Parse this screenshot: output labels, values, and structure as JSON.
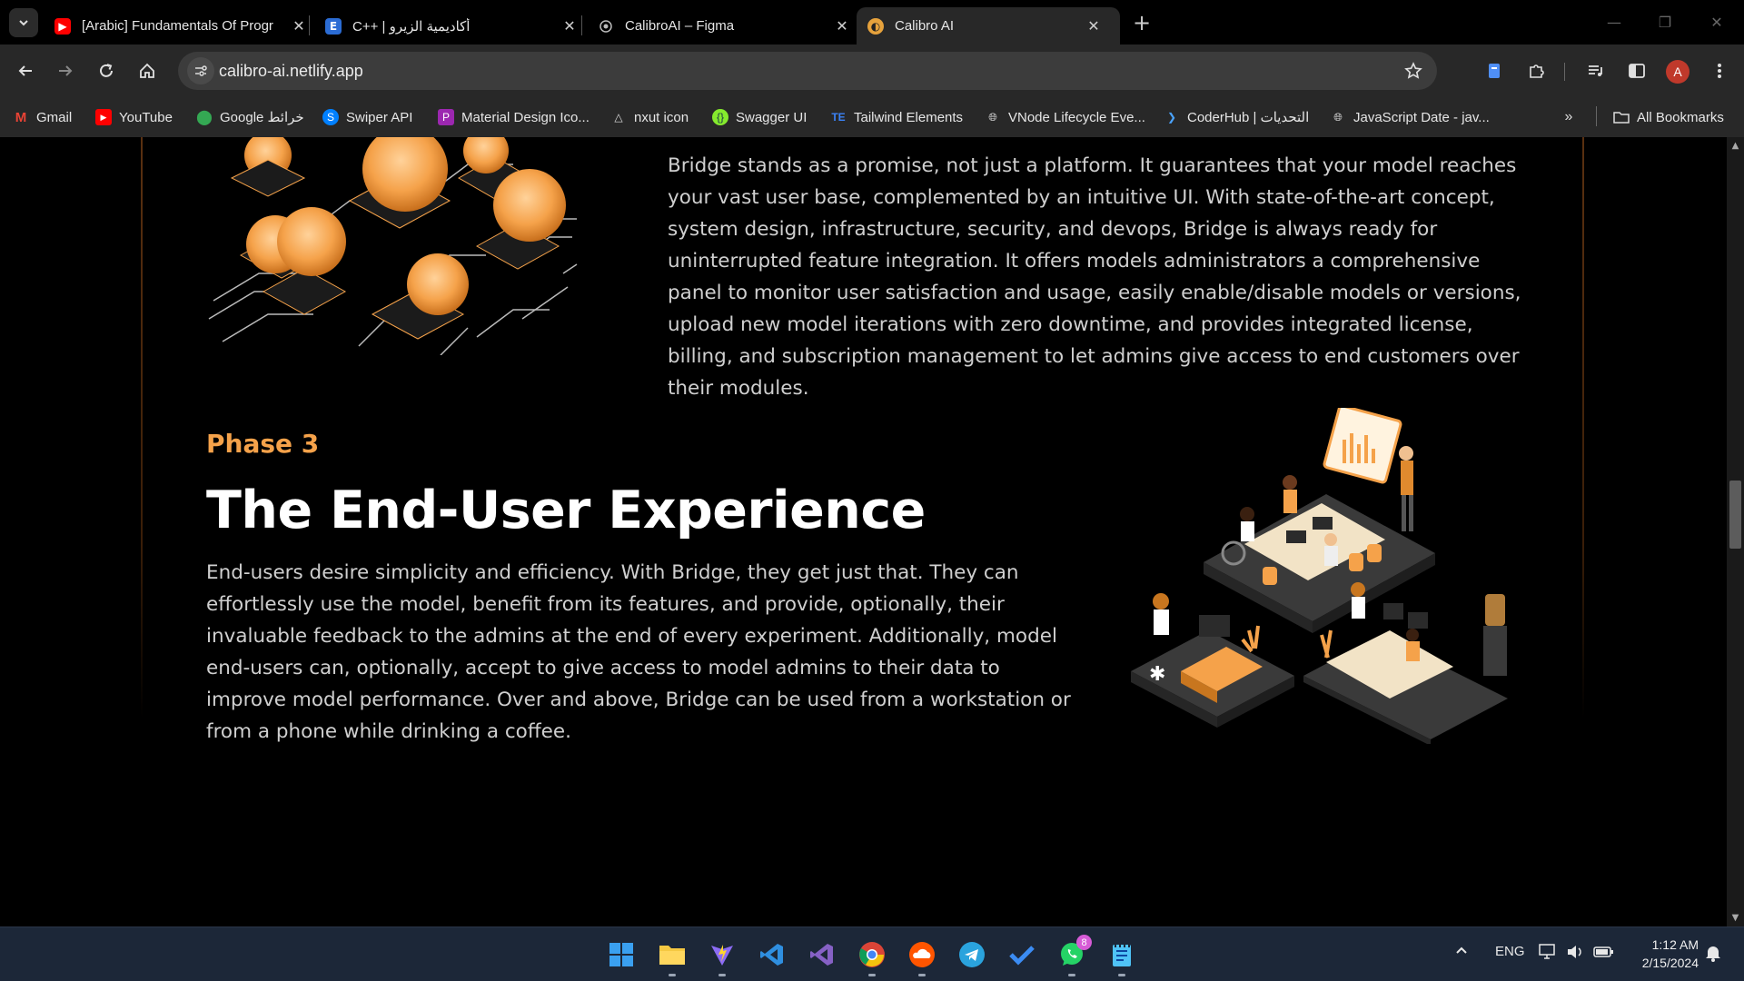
{
  "browser": {
    "tabs": [
      {
        "title": "[Arabic] Fundamentals Of Progr",
        "favicon": "youtube-icon",
        "active": false
      },
      {
        "title": "C++ | أكاديمية الزيرو",
        "favicon": "e-icon",
        "active": false
      },
      {
        "title": "CalibroAI – Figma",
        "favicon": "figma-icon",
        "active": false
      },
      {
        "title": "Calibro AI",
        "favicon": "calibro-icon",
        "active": true
      }
    ],
    "url": "calibro-ai.netlify.app",
    "avatar_letter": "A",
    "bookmarks": [
      {
        "label": "Gmail",
        "icon": "gmail-icon"
      },
      {
        "label": "YouTube",
        "icon": "youtube-icon"
      },
      {
        "label": "Google خرائط",
        "icon": "maps-icon"
      },
      {
        "label": "Swiper API",
        "icon": "swiper-icon"
      },
      {
        "label": "Material Design Ico...",
        "icon": "material-icon"
      },
      {
        "label": "nxut icon",
        "icon": "nuxt-icon"
      },
      {
        "label": "Swagger UI",
        "icon": "swagger-icon"
      },
      {
        "label": "Tailwind Elements",
        "icon": "tailwind-icon"
      },
      {
        "label": "VNode Lifecycle Eve...",
        "icon": "globe-icon"
      },
      {
        "label": "CoderHub | التحديات",
        "icon": "coderhub-icon"
      },
      {
        "label": "JavaScript Date - jav...",
        "icon": "globe-icon"
      }
    ],
    "all_bookmarks_label": "All Bookmarks"
  },
  "page": {
    "top_paragraph": "Bridge stands as a promise, not just a platform. It guarantees that your model reaches your vast user base, complemented by an intuitive UI. With state-of-the-art concept, system design, infrastructure, security, and devops, Bridge is always ready for uninterrupted feature integration. It offers models administrators a comprehensive panel to monitor user satisfaction and usage, easily enable/disable models or versions, upload new model iterations with zero downtime, and provides integrated license, billing, and subscription management to let admins give access to end customers over their modules.",
    "phase_label": "Phase 3",
    "heading": "The End-User Experience",
    "body_paragraph": "End-users desire simplicity and efficiency. With Bridge, they get just that. They can effortlessly use the model, benefit from its features, and provide, optionally, their invaluable feedback to the admins at the end of every experiment. Additionally, model end-users can, optionally, accept to give access to model admins to their data to improve model performance. Over and above, Bridge can be used from a workstation or from a phone while drinking a coffee.",
    "accent_color": "#f5a24a"
  },
  "taskbar": {
    "apps": [
      "windows-start-icon",
      "file-explorer-icon",
      "vite-icon",
      "vscode-icon",
      "visual-studio-icon",
      "chrome-icon",
      "soundcloud-icon",
      "telegram-icon",
      "todo-icon",
      "whatsapp-icon",
      "notepad-icon"
    ],
    "whatsapp_badge": "8",
    "language": "ENG",
    "time": "1:12 AM",
    "date": "2/15/2024"
  }
}
